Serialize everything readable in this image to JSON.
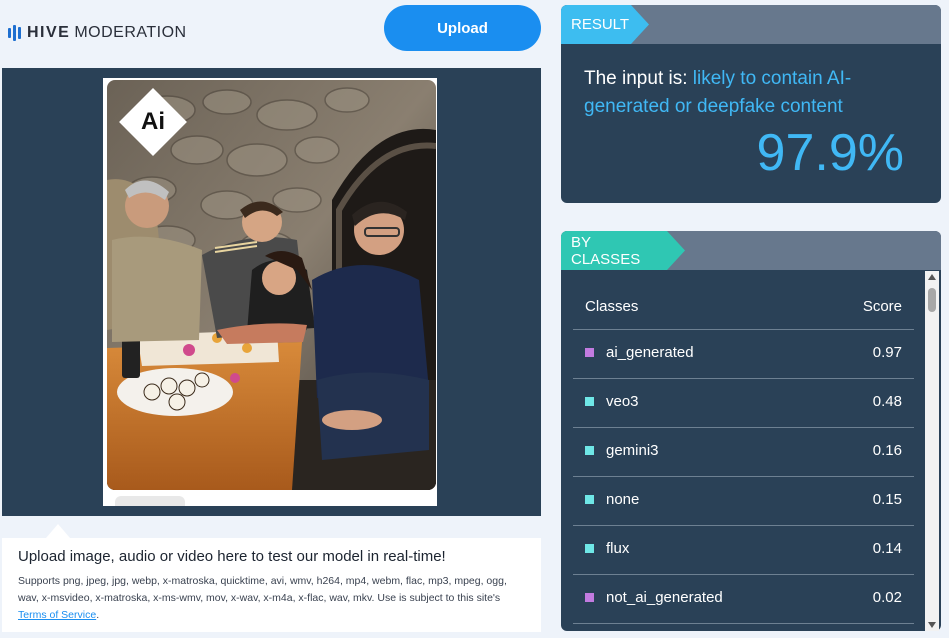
{
  "header": {
    "logo_bold": "HIVE",
    "logo_light": "MODERATION",
    "upload_label": "Upload"
  },
  "preview": {
    "badge_label": "Ai"
  },
  "info": {
    "title": "Upload image, audio or video here to test our model in real-time!",
    "supports_text": "Supports png, jpeg, jpg, webp, x-matroska, quicktime, avi, wmv, h264, mp4, webm, flac, mp3, mpeg, ogg, wav, x-msvideo, x-matroska, x-ms-wmv, mov, x-wav, x-m4a, x-flac, wav, mkv. Use is subject to this site's",
    "tos_link": "Terms of Service",
    "tos_suffix": "."
  },
  "result": {
    "tag": "RESULT",
    "prefix": "The input is:",
    "verdict": "likely to contain AI-generated or deepfake content",
    "percent": "97.9%"
  },
  "classes": {
    "tag": "BY CLASSES",
    "col_class": "Classes",
    "col_score": "Score",
    "rows": [
      {
        "name": "ai_generated",
        "score": "0.97",
        "color": "#c27be0"
      },
      {
        "name": "veo3",
        "score": "0.48",
        "color": "#6fe7e7"
      },
      {
        "name": "gemini3",
        "score": "0.16",
        "color": "#6fe7e7"
      },
      {
        "name": "none",
        "score": "0.15",
        "color": "#6fe7e7"
      },
      {
        "name": "flux",
        "score": "0.14",
        "color": "#6fe7e7"
      },
      {
        "name": "not_ai_generated",
        "score": "0.02",
        "color": "#c27be0"
      }
    ]
  },
  "colors": {
    "accent_blue": "#1a8ef0",
    "panel_bg": "#2a4157",
    "result_tag": "#3dbdf0",
    "classes_tag": "#2fc7b3"
  }
}
